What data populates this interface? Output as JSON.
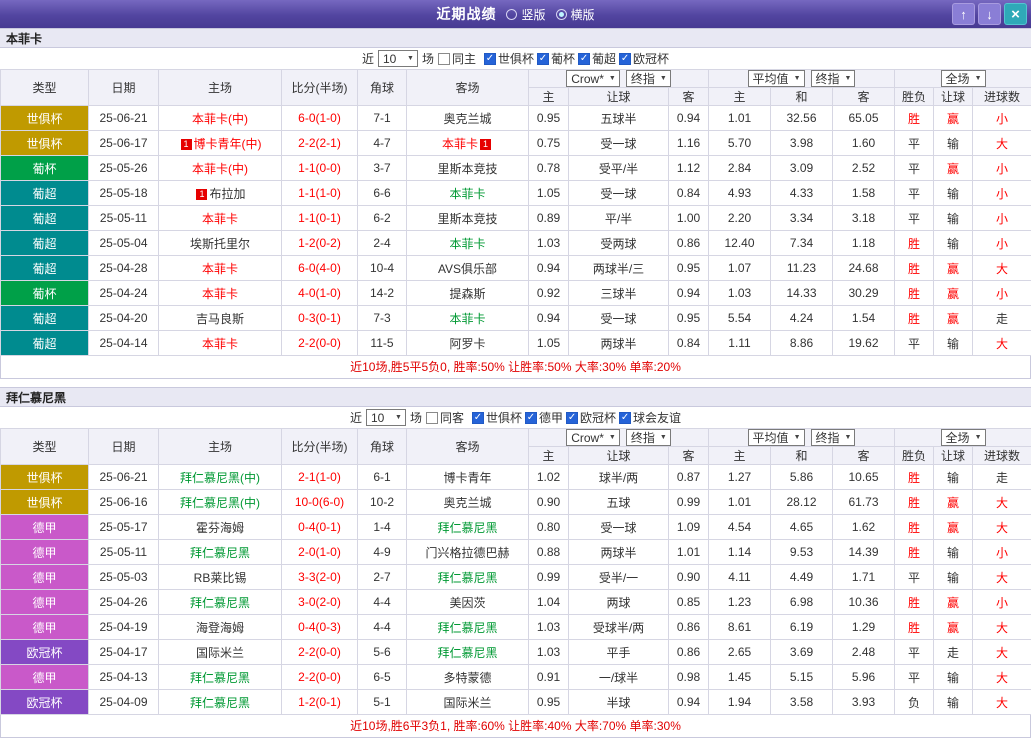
{
  "titlebar": {
    "title": "近期战绩",
    "radios": [
      {
        "label": "竖版",
        "selected": false
      },
      {
        "label": "横版",
        "selected": true
      }
    ],
    "up_icon": "↑",
    "down_icon": "↓",
    "close_icon": "×"
  },
  "common": {
    "near_label": "近",
    "matches_label": "场",
    "dropdowns": [
      "Crow*",
      "终指",
      "平均值",
      "终指",
      "全场"
    ],
    "columns": [
      "类型",
      "日期",
      "主场",
      "比分(半场)",
      "角球",
      "客场",
      "主",
      "让球",
      "客",
      "主",
      "和",
      "客",
      "胜负",
      "让球",
      "进球数"
    ]
  },
  "league_colors": {
    "世俱杯": "#c09a00",
    "葡杯": "#00a048",
    "葡超": "#008b8f",
    "德甲": "#c959c9",
    "欧冠杯": "#8449c4"
  },
  "colors": {
    "titlebar_purple": "#5245a0",
    "nav_button_purple": "#8a7ed6",
    "close_teal": "#2fa9b8",
    "checkbox_blue": "#2563d8",
    "win_red": "#ff0000",
    "away_team_green": "#009933",
    "summary_red": "#e00000"
  },
  "sections": [
    {
      "team": "本菲卡",
      "near_count": "10",
      "same_label": "同主",
      "league_filters": [
        "世俱杯",
        "葡杯",
        "葡超",
        "欧冠杯"
      ],
      "rows": [
        {
          "lg": "世俱杯",
          "date": "25-06-21",
          "home": {
            "t": "本菲卡(中)",
            "c": "red"
          },
          "score": "6-0(1-0)",
          "cor": "7-1",
          "away": {
            "t": "奥克兰城",
            "c": "dark"
          },
          "ah": [
            "0.95",
            "五球半",
            "0.94"
          ],
          "eu": [
            "1.01",
            "32.56",
            "65.05"
          ],
          "res": {
            "t": "胜",
            "c": "red"
          },
          "let": {
            "t": "赢",
            "c": "red"
          },
          "goal": {
            "t": "小",
            "c": "red"
          }
        },
        {
          "lg": "世俱杯",
          "date": "25-06-17",
          "home": {
            "t": "博卡青年(中)",
            "c": "red",
            "badge": "1",
            "bpos": "before"
          },
          "score": "2-2(2-1)",
          "cor": "4-7",
          "away": {
            "t": "本菲卡",
            "c": "red",
            "badge": "1",
            "bpos": "after"
          },
          "ah": [
            "0.75",
            "受一球",
            "1.16"
          ],
          "eu": [
            "5.70",
            "3.98",
            "1.60"
          ],
          "res": {
            "t": "平",
            "c": "dark"
          },
          "let": {
            "t": "输",
            "c": "dark"
          },
          "goal": {
            "t": "大",
            "c": "red"
          }
        },
        {
          "lg": "葡杯",
          "date": "25-05-26",
          "home": {
            "t": "本菲卡(中)",
            "c": "red"
          },
          "score": "1-1(0-0)",
          "cor": "3-7",
          "away": {
            "t": "里斯本竞技",
            "c": "dark"
          },
          "ah": [
            "0.78",
            "受平/半",
            "1.12"
          ],
          "eu": [
            "2.84",
            "3.09",
            "2.52"
          ],
          "res": {
            "t": "平",
            "c": "dark"
          },
          "let": {
            "t": "赢",
            "c": "red"
          },
          "goal": {
            "t": "小",
            "c": "red"
          }
        },
        {
          "lg": "葡超",
          "date": "25-05-18",
          "home": {
            "t": "布拉加",
            "c": "dark",
            "badge": "1",
            "bpos": "before"
          },
          "score": "1-1(1-0)",
          "cor": "6-6",
          "away": {
            "t": "本菲卡",
            "c": "green"
          },
          "ah": [
            "1.05",
            "受一球",
            "0.84"
          ],
          "eu": [
            "4.93",
            "4.33",
            "1.58"
          ],
          "res": {
            "t": "平",
            "c": "dark"
          },
          "let": {
            "t": "输",
            "c": "dark"
          },
          "goal": {
            "t": "小",
            "c": "red"
          }
        },
        {
          "lg": "葡超",
          "date": "25-05-11",
          "home": {
            "t": "本菲卡",
            "c": "red"
          },
          "score": "1-1(0-1)",
          "cor": "6-2",
          "away": {
            "t": "里斯本竞技",
            "c": "dark"
          },
          "ah": [
            "0.89",
            "平/半",
            "1.00"
          ],
          "eu": [
            "2.20",
            "3.34",
            "3.18"
          ],
          "res": {
            "t": "平",
            "c": "dark"
          },
          "let": {
            "t": "输",
            "c": "dark"
          },
          "goal": {
            "t": "小",
            "c": "red"
          }
        },
        {
          "lg": "葡超",
          "date": "25-05-04",
          "home": {
            "t": "埃斯托里尔",
            "c": "dark"
          },
          "score": "1-2(0-2)",
          "cor": "2-4",
          "away": {
            "t": "本菲卡",
            "c": "green"
          },
          "ah": [
            "1.03",
            "受两球",
            "0.86"
          ],
          "eu": [
            "12.40",
            "7.34",
            "1.18"
          ],
          "res": {
            "t": "胜",
            "c": "red"
          },
          "let": {
            "t": "输",
            "c": "dark"
          },
          "goal": {
            "t": "小",
            "c": "red"
          }
        },
        {
          "lg": "葡超",
          "date": "25-04-28",
          "home": {
            "t": "本菲卡",
            "c": "red"
          },
          "score": "6-0(4-0)",
          "cor": "10-4",
          "away": {
            "t": "AVS俱乐部",
            "c": "dark"
          },
          "ah": [
            "0.94",
            "两球半/三",
            "0.95"
          ],
          "eu": [
            "1.07",
            "11.23",
            "24.68"
          ],
          "res": {
            "t": "胜",
            "c": "red"
          },
          "let": {
            "t": "赢",
            "c": "red"
          },
          "goal": {
            "t": "大",
            "c": "red"
          }
        },
        {
          "lg": "葡杯",
          "date": "25-04-24",
          "home": {
            "t": "本菲卡",
            "c": "red"
          },
          "score": "4-0(1-0)",
          "cor": "14-2",
          "away": {
            "t": "提森斯",
            "c": "dark"
          },
          "ah": [
            "0.92",
            "三球半",
            "0.94"
          ],
          "eu": [
            "1.03",
            "14.33",
            "30.29"
          ],
          "res": {
            "t": "胜",
            "c": "red"
          },
          "let": {
            "t": "赢",
            "c": "red"
          },
          "goal": {
            "t": "小",
            "c": "red"
          }
        },
        {
          "lg": "葡超",
          "date": "25-04-20",
          "home": {
            "t": "吉马良斯",
            "c": "dark"
          },
          "score": "0-3(0-1)",
          "cor": "7-3",
          "away": {
            "t": "本菲卡",
            "c": "green"
          },
          "ah": [
            "0.94",
            "受一球",
            "0.95"
          ],
          "eu": [
            "5.54",
            "4.24",
            "1.54"
          ],
          "res": {
            "t": "胜",
            "c": "red"
          },
          "let": {
            "t": "赢",
            "c": "red"
          },
          "goal": {
            "t": "走",
            "c": "dark"
          }
        },
        {
          "lg": "葡超",
          "date": "25-04-14",
          "home": {
            "t": "本菲卡",
            "c": "red"
          },
          "score": "2-2(0-0)",
          "cor": "11-5",
          "away": {
            "t": "阿罗卡",
            "c": "dark"
          },
          "ah": [
            "1.05",
            "两球半",
            "0.84"
          ],
          "eu": [
            "1.11",
            "8.86",
            "19.62"
          ],
          "res": {
            "t": "平",
            "c": "dark"
          },
          "let": {
            "t": "输",
            "c": "dark"
          },
          "goal": {
            "t": "大",
            "c": "red"
          }
        }
      ],
      "summary": "近10场,胜5平5负0, 胜率:50% 让胜率:50% 大率:30% 单率:20%"
    },
    {
      "team": "拜仁慕尼黑",
      "near_count": "10",
      "same_label": "同客",
      "league_filters": [
        "世俱杯",
        "德甲",
        "欧冠杯",
        "球会友谊"
      ],
      "rows": [
        {
          "lg": "世俱杯",
          "date": "25-06-21",
          "home": {
            "t": "拜仁慕尼黑(中)",
            "c": "green"
          },
          "score": "2-1(1-0)",
          "cor": "6-1",
          "away": {
            "t": "博卡青年",
            "c": "dark"
          },
          "ah": [
            "1.02",
            "球半/两",
            "0.87"
          ],
          "eu": [
            "1.27",
            "5.86",
            "10.65"
          ],
          "res": {
            "t": "胜",
            "c": "red"
          },
          "let": {
            "t": "输",
            "c": "dark"
          },
          "goal": {
            "t": "走",
            "c": "dark"
          }
        },
        {
          "lg": "世俱杯",
          "date": "25-06-16",
          "home": {
            "t": "拜仁慕尼黑(中)",
            "c": "green"
          },
          "score": "10-0(6-0)",
          "cor": "10-2",
          "away": {
            "t": "奥克兰城",
            "c": "dark"
          },
          "ah": [
            "0.90",
            "五球",
            "0.99"
          ],
          "eu": [
            "1.01",
            "28.12",
            "61.73"
          ],
          "res": {
            "t": "胜",
            "c": "red"
          },
          "let": {
            "t": "赢",
            "c": "red"
          },
          "goal": {
            "t": "大",
            "c": "red"
          }
        },
        {
          "lg": "德甲",
          "date": "25-05-17",
          "home": {
            "t": "霍芬海姆",
            "c": "dark"
          },
          "score": "0-4(0-1)",
          "cor": "1-4",
          "away": {
            "t": "拜仁慕尼黑",
            "c": "green"
          },
          "ah": [
            "0.80",
            "受一球",
            "1.09"
          ],
          "eu": [
            "4.54",
            "4.65",
            "1.62"
          ],
          "res": {
            "t": "胜",
            "c": "red"
          },
          "let": {
            "t": "赢",
            "c": "red"
          },
          "goal": {
            "t": "大",
            "c": "red"
          }
        },
        {
          "lg": "德甲",
          "date": "25-05-11",
          "home": {
            "t": "拜仁慕尼黑",
            "c": "green"
          },
          "score": "2-0(1-0)",
          "cor": "4-9",
          "away": {
            "t": "门兴格拉德巴赫",
            "c": "dark"
          },
          "ah": [
            "0.88",
            "两球半",
            "1.01"
          ],
          "eu": [
            "1.14",
            "9.53",
            "14.39"
          ],
          "res": {
            "t": "胜",
            "c": "red"
          },
          "let": {
            "t": "输",
            "c": "dark"
          },
          "goal": {
            "t": "小",
            "c": "red"
          }
        },
        {
          "lg": "德甲",
          "date": "25-05-03",
          "home": {
            "t": "RB莱比锡",
            "c": "dark"
          },
          "score": "3-3(2-0)",
          "cor": "2-7",
          "away": {
            "t": "拜仁慕尼黑",
            "c": "green"
          },
          "ah": [
            "0.99",
            "受半/一",
            "0.90"
          ],
          "eu": [
            "4.11",
            "4.49",
            "1.71"
          ],
          "res": {
            "t": "平",
            "c": "dark"
          },
          "let": {
            "t": "输",
            "c": "dark"
          },
          "goal": {
            "t": "大",
            "c": "red"
          }
        },
        {
          "lg": "德甲",
          "date": "25-04-26",
          "home": {
            "t": "拜仁慕尼黑",
            "c": "green"
          },
          "score": "3-0(2-0)",
          "cor": "4-4",
          "away": {
            "t": "美因茨",
            "c": "dark"
          },
          "ah": [
            "1.04",
            "两球",
            "0.85"
          ],
          "eu": [
            "1.23",
            "6.98",
            "10.36"
          ],
          "res": {
            "t": "胜",
            "c": "red"
          },
          "let": {
            "t": "赢",
            "c": "red"
          },
          "goal": {
            "t": "小",
            "c": "red"
          }
        },
        {
          "lg": "德甲",
          "date": "25-04-19",
          "home": {
            "t": "海登海姆",
            "c": "dark"
          },
          "score": "0-4(0-3)",
          "cor": "4-4",
          "away": {
            "t": "拜仁慕尼黑",
            "c": "green"
          },
          "ah": [
            "1.03",
            "受球半/两",
            "0.86"
          ],
          "eu": [
            "8.61",
            "6.19",
            "1.29"
          ],
          "res": {
            "t": "胜",
            "c": "red"
          },
          "let": {
            "t": "赢",
            "c": "red"
          },
          "goal": {
            "t": "大",
            "c": "red"
          }
        },
        {
          "lg": "欧冠杯",
          "date": "25-04-17",
          "home": {
            "t": "国际米兰",
            "c": "dark"
          },
          "score": "2-2(0-0)",
          "cor": "5-6",
          "away": {
            "t": "拜仁慕尼黑",
            "c": "green"
          },
          "ah": [
            "1.03",
            "平手",
            "0.86"
          ],
          "eu": [
            "2.65",
            "3.69",
            "2.48"
          ],
          "res": {
            "t": "平",
            "c": "dark"
          },
          "let": {
            "t": "走",
            "c": "dark"
          },
          "goal": {
            "t": "大",
            "c": "red"
          }
        },
        {
          "lg": "德甲",
          "date": "25-04-13",
          "home": {
            "t": "拜仁慕尼黑",
            "c": "green"
          },
          "score": "2-2(0-0)",
          "cor": "6-5",
          "away": {
            "t": "多特蒙德",
            "c": "dark"
          },
          "ah": [
            "0.91",
            "一/球半",
            "0.98"
          ],
          "eu": [
            "1.45",
            "5.15",
            "5.96"
          ],
          "res": {
            "t": "平",
            "c": "dark"
          },
          "let": {
            "t": "输",
            "c": "dark"
          },
          "goal": {
            "t": "大",
            "c": "red"
          }
        },
        {
          "lg": "欧冠杯",
          "date": "25-04-09",
          "home": {
            "t": "拜仁慕尼黑",
            "c": "green"
          },
          "score": "1-2(0-1)",
          "cor": "5-1",
          "away": {
            "t": "国际米兰",
            "c": "dark"
          },
          "ah": [
            "0.95",
            "半球",
            "0.94"
          ],
          "eu": [
            "1.94",
            "3.58",
            "3.93"
          ],
          "res": {
            "t": "负",
            "c": "dark"
          },
          "let": {
            "t": "输",
            "c": "dark"
          },
          "goal": {
            "t": "大",
            "c": "red"
          }
        }
      ],
      "summary": "近10场,胜6平3负1, 胜率:60% 让胜率:40% 大率:70% 单率:30%"
    }
  ]
}
